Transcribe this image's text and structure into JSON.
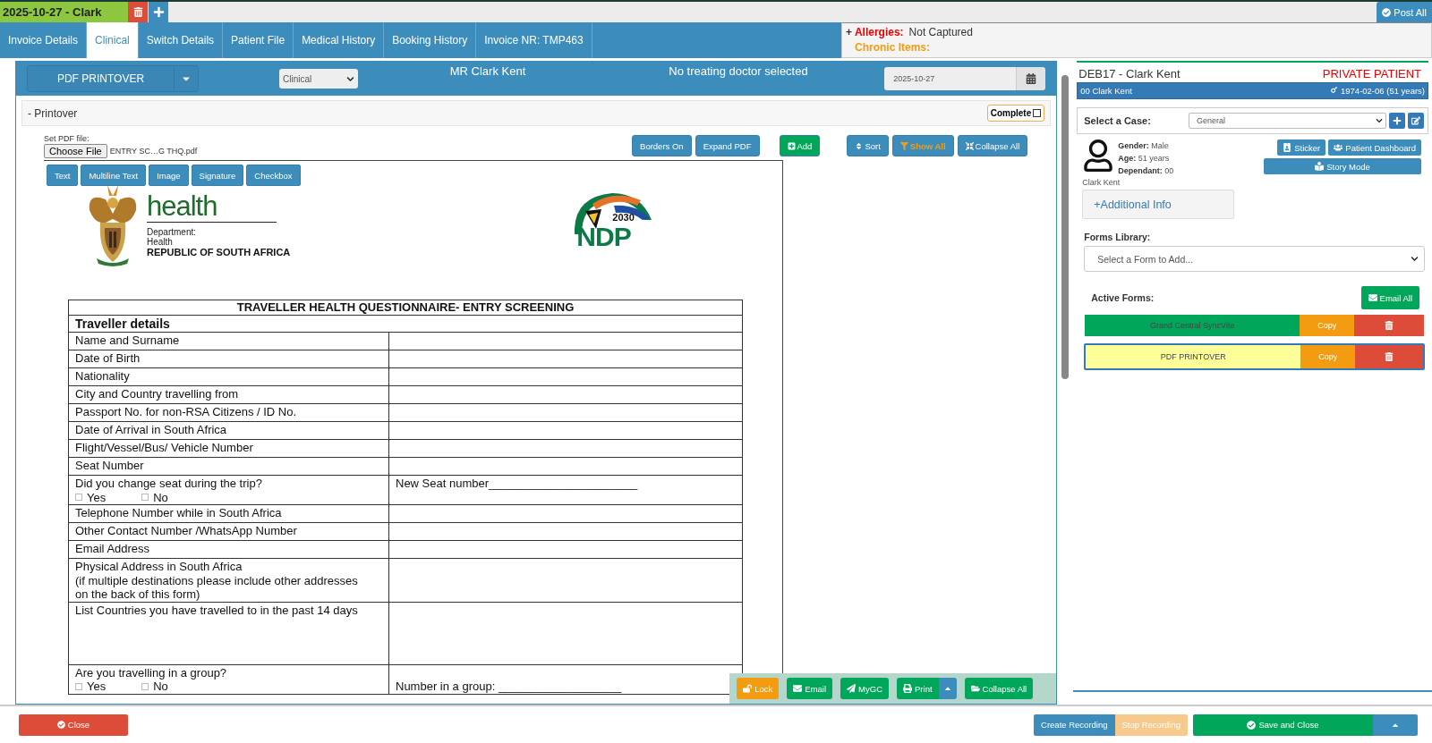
{
  "session_tab": {
    "label": "2025-10-27 - Clark"
  },
  "post_all": "Post All",
  "tabs": [
    {
      "label": "Invoice Details",
      "selected": false
    },
    {
      "label": "Clinical",
      "selected": true
    },
    {
      "label": "Switch Details",
      "selected": false
    },
    {
      "label": "Patient File",
      "selected": false
    },
    {
      "label": "Medical History",
      "selected": false
    },
    {
      "label": "Booking History",
      "selected": false
    },
    {
      "label": "Invoice NR: TMP463",
      "selected": false
    }
  ],
  "alerts": {
    "toggle": "+",
    "allergies_label": "Allergies:",
    "allergies_value": "Not Captured",
    "chronic_label": "Chronic Items:"
  },
  "form_header": {
    "form_name": "PDF PRINTOVER",
    "category": "Clinical",
    "patient": "MR Clark Kent",
    "doctor": "No treating doctor selected",
    "date": "2025-10-27"
  },
  "section": {
    "toggle": "-",
    "title": "Printover",
    "complete_label": "Complete",
    "complete_checked": false
  },
  "pdf": {
    "file_label": "Set PDF file:",
    "choose_button": "Choose File",
    "file_name": "ENTRY SC…G THQ.pdf"
  },
  "toolbar": [
    {
      "label": "Borders On",
      "kind": "plain"
    },
    {
      "label": "Expand PDF",
      "kind": "plain"
    },
    {
      "label": "Add",
      "kind": "add"
    },
    {
      "label": "Sort",
      "kind": "sort"
    },
    {
      "label": "Show All",
      "kind": "filter"
    },
    {
      "label": "Collapse All",
      "kind": "collapse"
    }
  ],
  "field_tools": [
    "Text",
    "Multiline Text",
    "Image",
    "Signature",
    "Checkbox"
  ],
  "document": {
    "logo_word": "health",
    "dept_line1": "Department:",
    "dept_line2": "Health",
    "country": "REPUBLIC OF SOUTH AFRICA",
    "ndp_year": "2030",
    "ndp_name": "NDP",
    "title": "TRAVELLER HEALTH QUESTIONNAIRE- ENTRY SCREENING",
    "section": "Traveller details",
    "rows": [
      {
        "kind": "text",
        "label": "Name and Surname"
      },
      {
        "kind": "text",
        "label": "Date of Birth"
      },
      {
        "kind": "text",
        "label": "Nationality"
      },
      {
        "kind": "text",
        "label": "City and Country travelling from"
      },
      {
        "kind": "text",
        "label": "Passport No. for non-RSA Citizens / ID No."
      },
      {
        "kind": "text",
        "label": "Date of Arrival in South Africa"
      },
      {
        "kind": "text",
        "label": "Flight/Vessel/Bus/ Vehicle Number"
      },
      {
        "kind": "text",
        "label": "Seat Number"
      },
      {
        "kind": "choice",
        "label": "Did you change seat during the trip?",
        "options": [
          {
            "label": "Yes",
            "checked": false
          },
          {
            "label": "No",
            "checked": false
          }
        ],
        "value": "New Seat number_______________________"
      },
      {
        "kind": "text",
        "label": "Telephone Number while in South Africa"
      },
      {
        "kind": "text",
        "label": "Other Contact Number /WhatsApp Number"
      },
      {
        "kind": "text",
        "label": "Email Address"
      },
      {
        "kind": "text",
        "label": "Physical Address in South Africa\n(if multiple destinations please include other addresses\non the back of this form)"
      },
      {
        "kind": "long",
        "label": "List Countries you have travelled to in the past 14 days"
      },
      {
        "kind": "choice",
        "label": "Are you travelling in a group?",
        "options": [
          {
            "label": "Yes",
            "checked": false
          },
          {
            "label": "No",
            "checked": false
          }
        ],
        "value": "Number in a group: ___________________"
      }
    ]
  },
  "float_actions": [
    {
      "label": "Lock",
      "kind": "lock"
    },
    {
      "label": "Email",
      "kind": "email"
    },
    {
      "label": "MyGC",
      "kind": "send"
    },
    {
      "label": "Print",
      "kind": "print"
    },
    {
      "label": "Collapse All",
      "kind": "folder"
    }
  ],
  "patient_panel": {
    "practice": "DEB17 - Clark Kent",
    "patient_type": "PRIVATE PATIENT",
    "member": "00 Clark Kent",
    "dob": "1974-02-06 (51 years)",
    "case_label": "Select a Case:",
    "case_value": "General",
    "details": [
      {
        "label": "Gender:",
        "value": "Male"
      },
      {
        "label": "Age:",
        "value": "51 years"
      },
      {
        "label": "Dependant:",
        "value": "00"
      }
    ],
    "name": "Clark Kent",
    "additional": "+Additional Info",
    "actions": [
      {
        "label": "Sticker",
        "kind": "sticker"
      },
      {
        "label": "Patient Dashboard",
        "kind": "dashboard"
      },
      {
        "label": "Story Mode",
        "kind": "story"
      }
    ],
    "forms_label": "Forms Library:",
    "forms_placeholder": "Select a Form to Add...",
    "active_label": "Active Forms:",
    "email_all": "Email All",
    "active_forms": [
      {
        "name": "Grand Central SyncVite",
        "copy": "Copy",
        "selected": false,
        "color": "#00a65a"
      },
      {
        "name": "PDF PRINTOVER",
        "copy": "Copy",
        "selected": true,
        "color": "#ffff99"
      }
    ]
  },
  "bottom": {
    "close": "Close",
    "recording": [
      {
        "label": "Create Recording",
        "disabled": false
      },
      {
        "label": "Stop Recording",
        "disabled": true
      }
    ],
    "save": "Save and Close"
  }
}
